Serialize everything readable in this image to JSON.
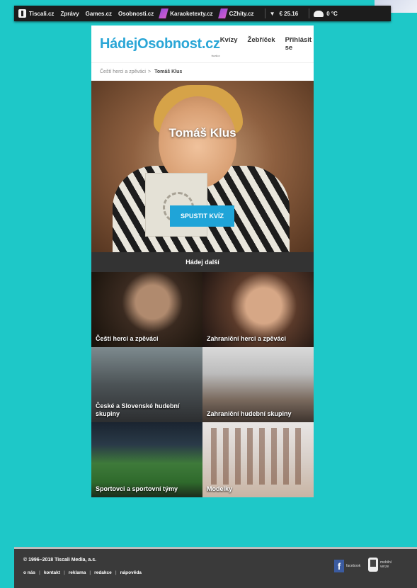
{
  "topbar": {
    "links": [
      "Tiscali.cz",
      "Zprávy",
      "Games.cz",
      "Osobnosti.cz",
      "Karaoketexty.cz",
      "CZhity.cz"
    ],
    "currency": "€ 25.16",
    "temperature": "0 °C"
  },
  "header": {
    "logo": "HádejOsobnost.cz",
    "logo_sub": "tiscali.cz",
    "nav": [
      "Kvízy",
      "Žebříček",
      "Přihlásit se"
    ]
  },
  "breadcrumb": {
    "parent": "Čeští herci a zpěváci",
    "separator": ">",
    "current": "Tomáš Klus"
  },
  "hero": {
    "name": "Tomáš Klus",
    "button": "SPUSTIT KVÍZ"
  },
  "next_heading": "Hádej další",
  "categories": [
    "Čeští herci a zpěváci",
    "Zahraniční herci a zpěváci",
    "České a Slovenské hudební skupiny",
    "Zahraniční hudební skupiny",
    "Sportovci a sportovní týmy",
    "Modelky"
  ],
  "footer": {
    "copyright": "© 1996–2018  Tiscali Media, a.s.",
    "links": [
      "o nás",
      "kontakt",
      "reklama",
      "redakce",
      "nápověda"
    ],
    "facebook": "facebook",
    "mobile": "mobilní verze"
  }
}
